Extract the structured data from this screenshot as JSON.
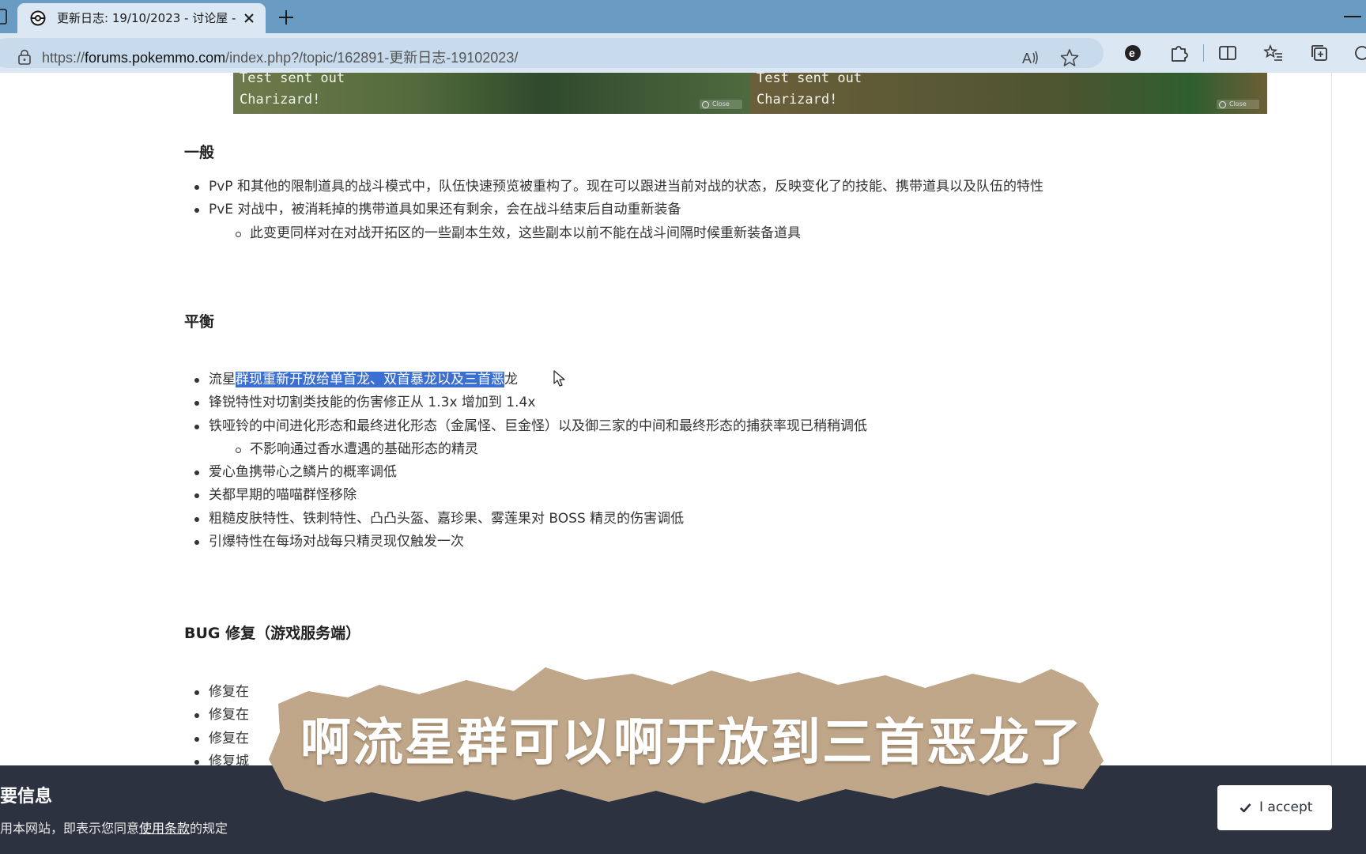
{
  "browser": {
    "tab_title": "更新日志: 19/10/2023 - 讨论屋 -",
    "url_prefix": "https://",
    "url_host": "forums.pokemmo.com",
    "url_path": "/index.php?/topic/162891-更新日志-19102023/",
    "tab_bg_color": "#6a9bc3",
    "toolbar_color": "#dbe7f2"
  },
  "game_screens": {
    "left_line1": "Test sent out",
    "left_line2": "Charizard!",
    "right_line1": "Test sent out",
    "right_line2": "Charizard!",
    "close_label": "Close"
  },
  "sections": {
    "general": {
      "title": "一般",
      "items": [
        "PvP 和其他的限制道具的战斗模式中，队伍快速预览被重构了。现在可以跟进当前对战的状态，反映变化了的技能、携带道具以及队伍的特性",
        "PvE 对战中，被消耗掉的携带道具如果还有剩余，会在战斗结束后自动重新装备"
      ],
      "sub_item": "此变更同样对在对战开拓区的一些副本生效，这些副本以前不能在战斗间隔时候重新装备道具"
    },
    "balance": {
      "title": "平衡",
      "first_item_prefix": "流星",
      "first_item_highlight": "群现重新开放给单首龙、双首暴龙以及三首恶",
      "first_item_suffix": "龙",
      "items": [
        "锋锐特性对切割类技能的伤害修正从 1.3x 增加到 1.4x",
        "铁哑铃的中间进化形态和最终进化形态（金属怪、巨金怪）以及御三家的中间和最终形态的捕获率现已稍稍调低"
      ],
      "sub_item": "不影响通过香水遭遇的基础形态的精灵",
      "items_after": [
        "爱心鱼携带心之鳞片的概率调低",
        "关都早期的喵喵群怪移除",
        "粗糙皮肤特性、铁刺特性、凸凸头盔、嘉珍果、雾莲果对 BOSS 精灵的伤害调低",
        "引爆特性在每场对战每只精灵现仅触发一次"
      ]
    },
    "bugfix": {
      "title": "BUG 修复（游戏服务端）",
      "items": [
        "修复在",
        "修复在",
        "修复在",
        "修复城"
      ]
    }
  },
  "caption": {
    "text": "啊流星群可以啊开放到三首恶龙了"
  },
  "cookie_bar": {
    "title": "要信息",
    "text_before": "用本网站，即表示您同意",
    "link": "使用条款",
    "text_after": "的规定",
    "accept_label": "I accept"
  }
}
